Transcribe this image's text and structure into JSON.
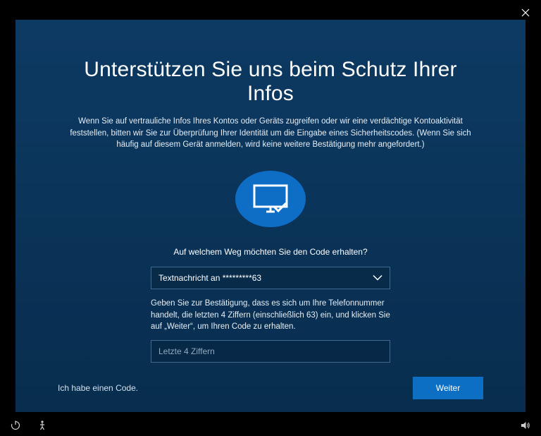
{
  "header": {
    "title": "Unterstützen Sie uns beim Schutz Ihrer Infos",
    "subtitle": "Wenn Sie auf vertrauliche Infos Ihres Kontos oder Geräts zugreifen oder wir eine verdächtige Kontoaktivität feststellen, bitten wir Sie zur Überprüfung Ihrer Identität um die Eingabe eines Sicherheitscodes. (Wenn Sie sich häufig auf diesem Gerät anmelden, wird keine weitere Bestätigung mehr angefordert.)"
  },
  "form": {
    "prompt": "Auf welchem Weg möchten Sie den Code erhalten?",
    "select_value": "Textnachricht an *********63",
    "helper_text": "Geben Sie zur Bestätigung, dass es sich um Ihre Telefonnummer handelt, die letzten 4 Ziffern (einschließlich 63) ein, und klicken Sie auf „Weiter“, um Ihren Code zu erhalten.",
    "input_placeholder": "Letzte 4 Ziffern"
  },
  "footer": {
    "link_label": "Ich habe einen Code.",
    "next_label": "Weiter"
  }
}
